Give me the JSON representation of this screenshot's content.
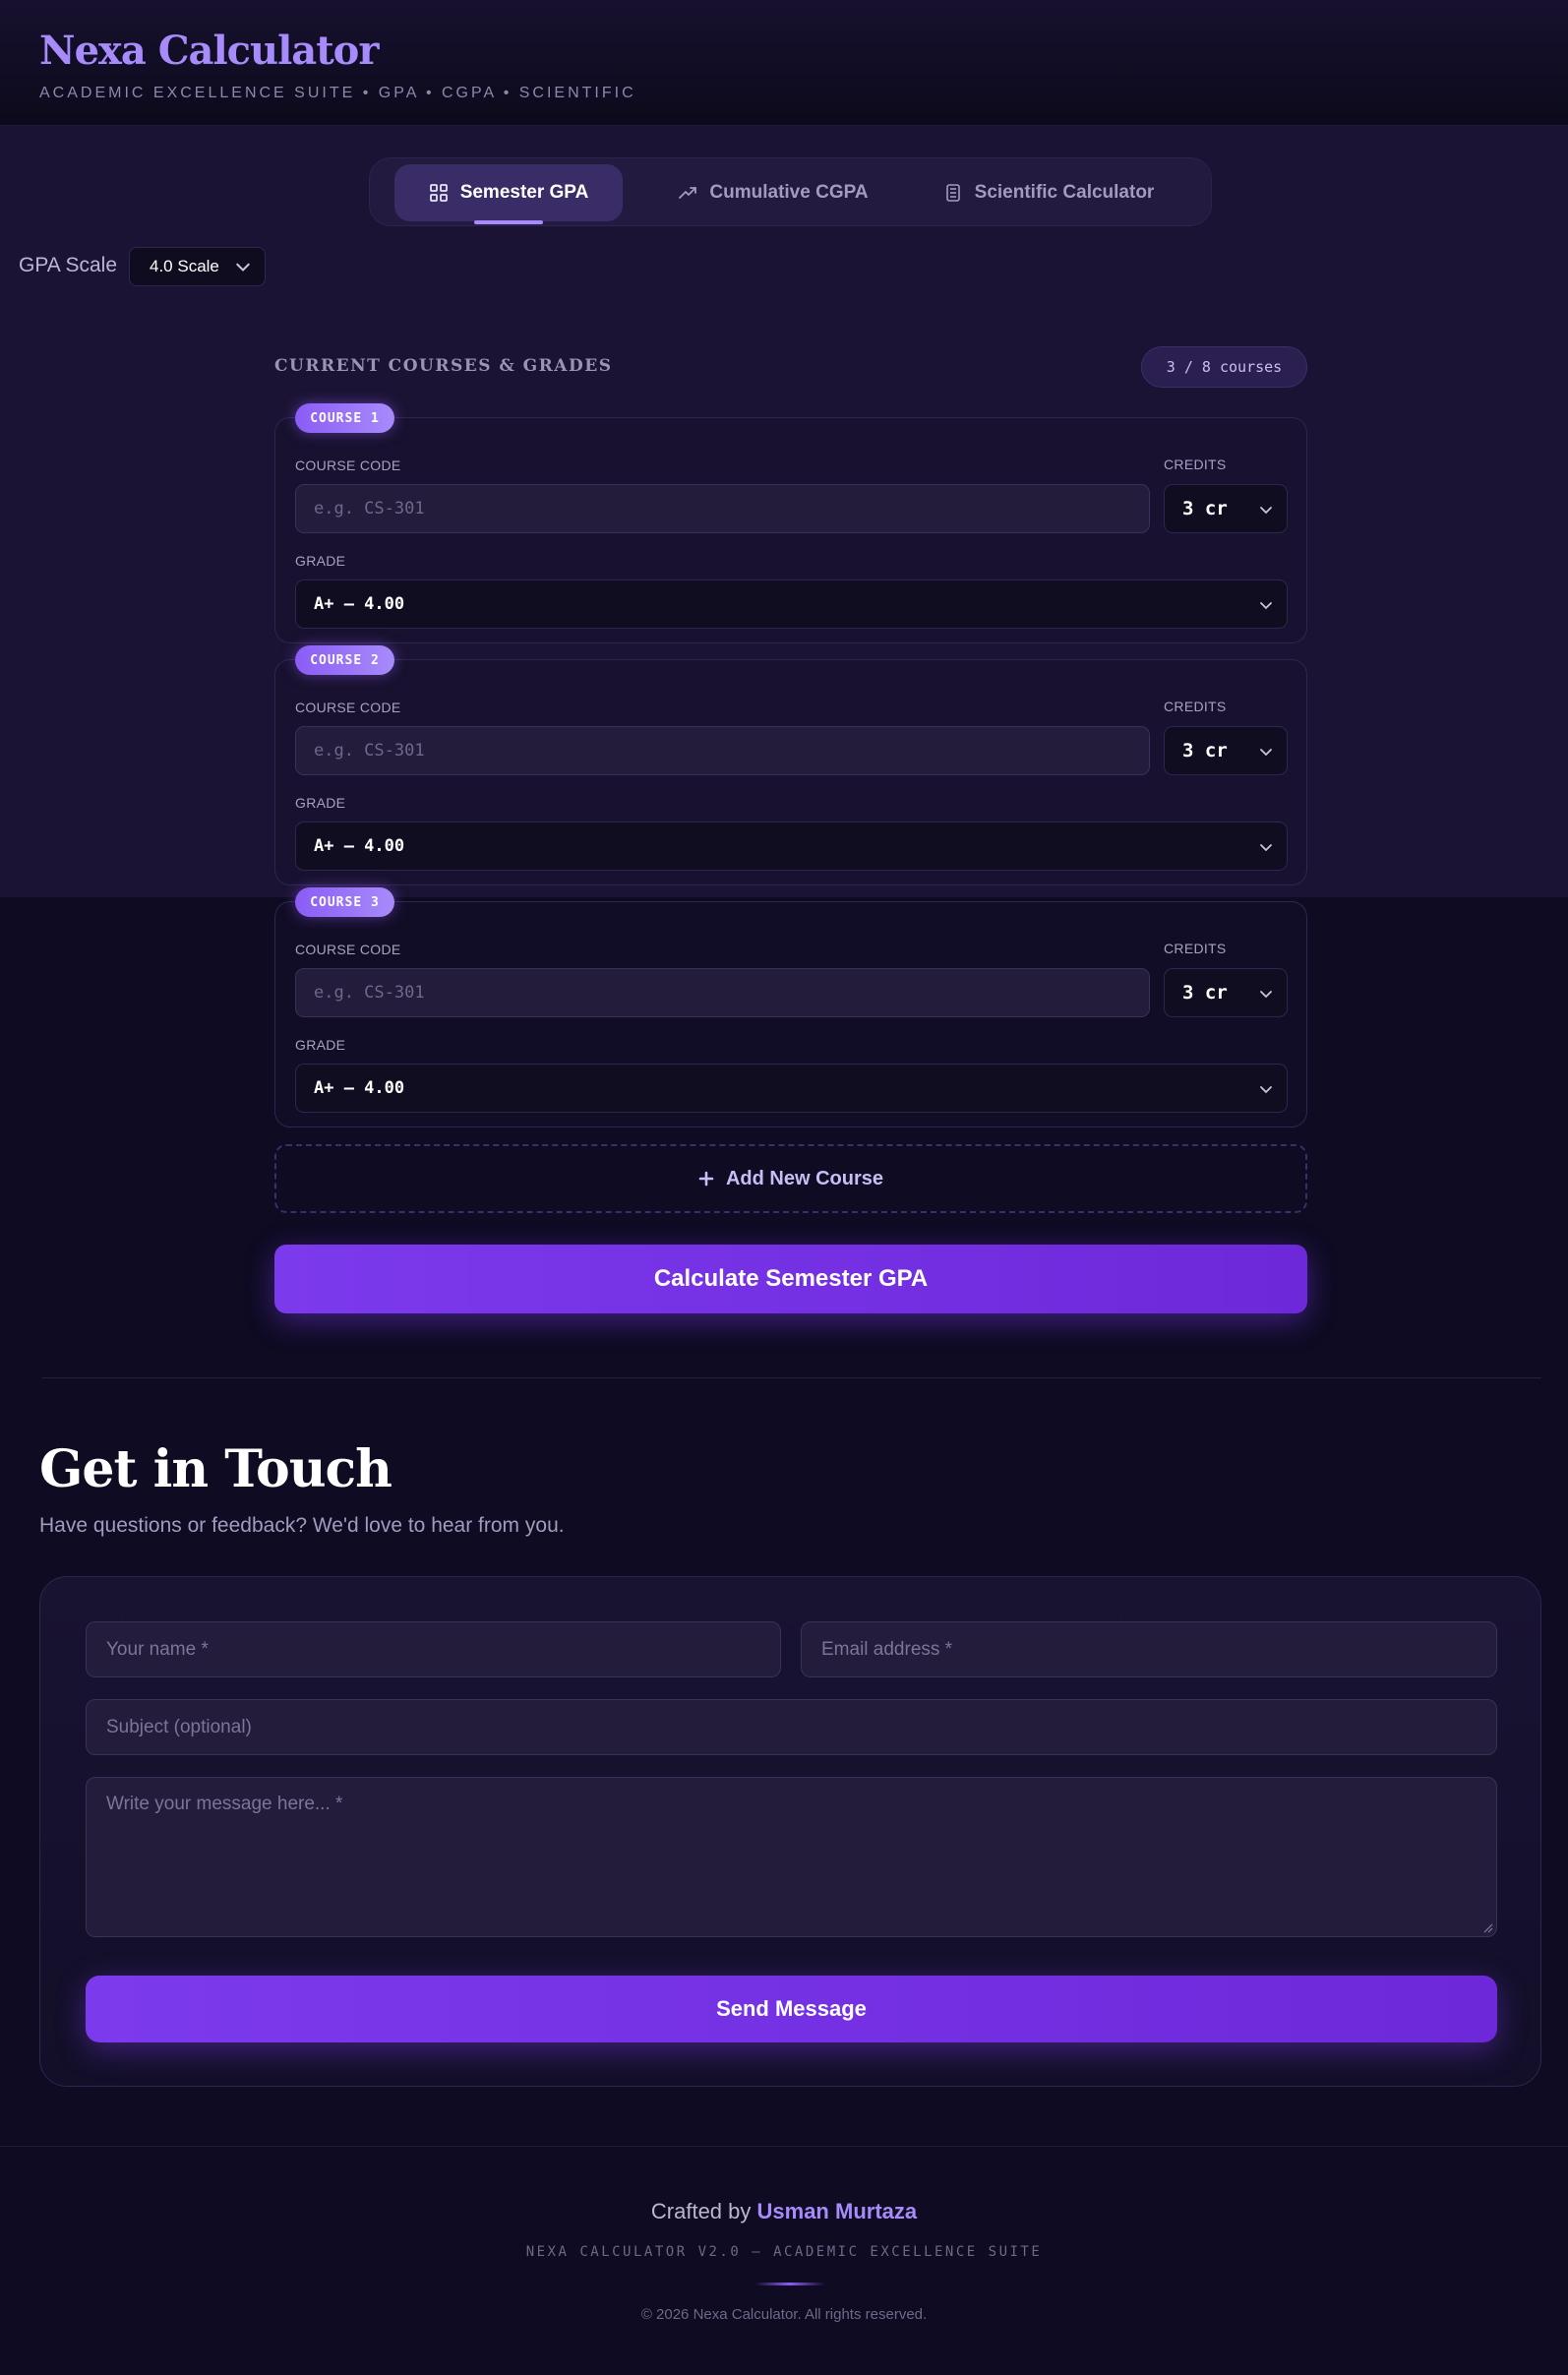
{
  "header": {
    "title": "Nexa Calculator",
    "tagline": "ACADEMIC EXCELLENCE SUITE • GPA • CGPA • SCIENTIFIC"
  },
  "tabs": [
    {
      "label": "Semester GPA",
      "icon": "grid-icon",
      "active": true
    },
    {
      "label": "Cumulative CGPA",
      "icon": "trend-up-icon",
      "active": false
    },
    {
      "label": "Scientific Calculator",
      "icon": "calculator-icon",
      "active": false
    }
  ],
  "gpa_scale": {
    "label": "GPA Scale",
    "selected": "4.0 Scale"
  },
  "courses_section": {
    "title": "CURRENT COURSES & GRADES",
    "count": "3 / 8 courses",
    "courses": [
      {
        "badge": "COURSE 1",
        "code_label": "COURSE CODE",
        "code_placeholder": "e.g. CS-301",
        "credits_label": "CREDITS",
        "credits_value": "3 cr",
        "grade_label": "GRADE",
        "grade_value": "A+ — 4.00"
      },
      {
        "badge": "COURSE 2",
        "code_label": "COURSE CODE",
        "code_placeholder": "e.g. CS-301",
        "credits_label": "CREDITS",
        "credits_value": "3 cr",
        "grade_label": "GRADE",
        "grade_value": "A+ — 4.00"
      },
      {
        "badge": "COURSE 3",
        "code_label": "COURSE CODE",
        "code_placeholder": "e.g. CS-301",
        "credits_label": "CREDITS",
        "credits_value": "3 cr",
        "grade_label": "GRADE",
        "grade_value": "A+ — 4.00"
      }
    ],
    "add_label": "Add New Course",
    "calculate_label": "Calculate Semester GPA"
  },
  "contact": {
    "title": "Get in Touch",
    "subtitle": "Have questions or feedback? We'd love to hear from you.",
    "name_placeholder": "Your name *",
    "email_placeholder": "Email address *",
    "subject_placeholder": "Subject (optional)",
    "message_placeholder": "Write your message here... *",
    "send_label": "Send Message"
  },
  "footer": {
    "crafted_prefix": "Crafted by",
    "author": "Usman Murtaza",
    "version": "NEXA CALCULATOR V2.0 — ACADEMIC EXCELLENCE SUITE",
    "copyright": "© 2026 Nexa Calculator. All rights reserved."
  },
  "colors": {
    "accent": "#a78bfa",
    "primary_button": "#7c3aed",
    "background": "#0e0b22"
  }
}
